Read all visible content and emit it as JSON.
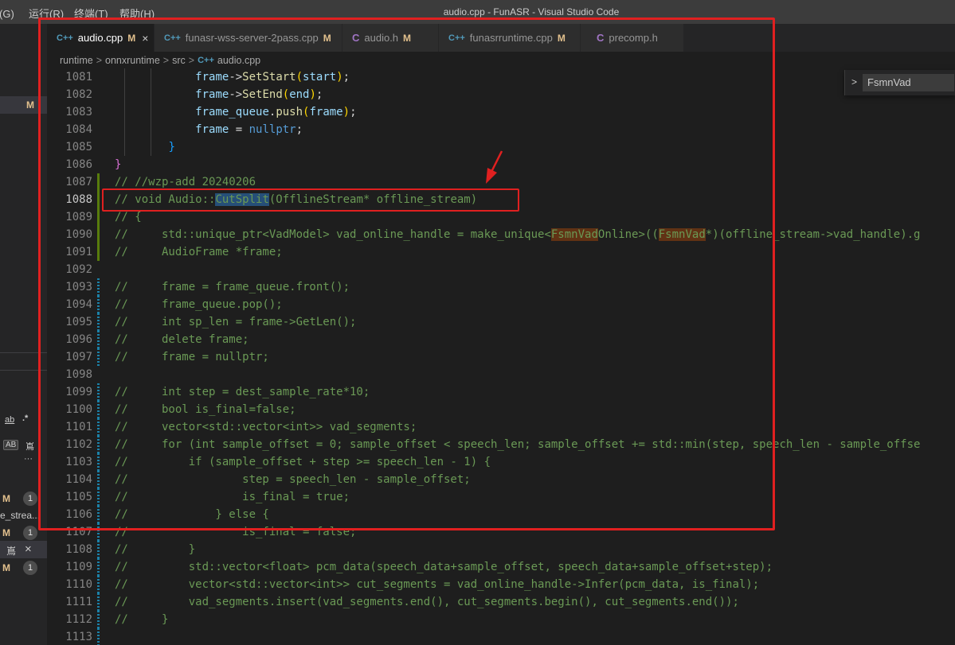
{
  "window": {
    "title": "audio.cpp - FunASR - Visual Studio Code"
  },
  "menu": {
    "items": [
      "运行(R)",
      "终端(T)",
      "帮助(H)"
    ],
    "cropped_item": "到(G)"
  },
  "tabs": [
    {
      "label": "audio.cpp",
      "icon": "C++",
      "modified": "M",
      "close": "×"
    },
    {
      "label": "funasr-wss-server-2pass.cpp",
      "icon": "C++",
      "modified": "M"
    },
    {
      "label": "audio.h",
      "icon": "C",
      "modified": "M"
    },
    {
      "label": "funasrruntime.cpp",
      "icon": "C++",
      "modified": "M"
    },
    {
      "label": "precomp.h",
      "icon": "C",
      "modified": ""
    }
  ],
  "breadcrumb": {
    "parts": [
      "runtime",
      "onnxruntime",
      "src"
    ],
    "file": "audio.cpp",
    "sep": ">",
    "file_icon": "C++"
  },
  "outline": {
    "value": "FsmnVad",
    "chevron": ">"
  },
  "sidebar": {
    "modified_mark": "M",
    "icon_ab": "ab",
    "icon_regex": ".*",
    "icon_AB": "AB",
    "icon_preserve": "嶌",
    "more": "···",
    "scm": [
      {
        "status": "M",
        "count": "1"
      },
      {
        "label": "e_strea...",
        "status": "",
        "count": ""
      },
      {
        "status": "M",
        "count": "1"
      },
      {
        "icon": "嶌",
        "close": "×"
      },
      {
        "status": "M",
        "count": "1"
      }
    ]
  },
  "code": {
    "current_line": 1088,
    "lines": [
      {
        "n": "1081",
        "t": "            frame->SetStart(start);"
      },
      {
        "n": "1082",
        "t": "            frame->SetEnd(end);"
      },
      {
        "n": "1083",
        "t": "            frame_queue.push(frame);"
      },
      {
        "n": "1084",
        "t": "            frame = nullptr;"
      },
      {
        "n": "1085",
        "t": "        }"
      },
      {
        "n": "1086",
        "t": "}"
      },
      {
        "n": "1087",
        "t": "// //wzp-add 20240206"
      },
      {
        "n": "1088",
        "t": "// void Audio::CutSplit(OfflineStream* offline_stream)"
      },
      {
        "n": "1089",
        "t": "// {"
      },
      {
        "n": "1090",
        "t": "//     std::unique_ptr<VadModel> vad_online_handle = make_unique<FsmnVadOnline>((FsmnVad*)(offline_stream->vad_handle).g"
      },
      {
        "n": "1091",
        "t": "//     AudioFrame *frame;"
      },
      {
        "n": "1092",
        "t": ""
      },
      {
        "n": "1093",
        "t": "//     frame = frame_queue.front();"
      },
      {
        "n": "1094",
        "t": "//     frame_queue.pop();"
      },
      {
        "n": "1095",
        "t": "//     int sp_len = frame->GetLen();"
      },
      {
        "n": "1096",
        "t": "//     delete frame;"
      },
      {
        "n": "1097",
        "t": "//     frame = nullptr;"
      },
      {
        "n": "1098",
        "t": ""
      },
      {
        "n": "1099",
        "t": "//     int step = dest_sample_rate*10;"
      },
      {
        "n": "1100",
        "t": "//     bool is_final=false;"
      },
      {
        "n": "1101",
        "t": "//     vector<std::vector<int>> vad_segments;"
      },
      {
        "n": "1102",
        "t": "//     for (int sample_offset = 0; sample_offset < speech_len; sample_offset += std::min(step, speech_len - sample_offse"
      },
      {
        "n": "1103",
        "t": "//         if (sample_offset + step >= speech_len - 1) {"
      },
      {
        "n": "1104",
        "t": "//                 step = speech_len - sample_offset;"
      },
      {
        "n": "1105",
        "t": "//                 is_final = true;"
      },
      {
        "n": "1106",
        "t": "//             } else {"
      },
      {
        "n": "1107",
        "t": "//                 is_final = false;"
      },
      {
        "n": "1108",
        "t": "//         }"
      },
      {
        "n": "1109",
        "t": "//         std::vector<float> pcm_data(speech_data+sample_offset, speech_data+sample_offset+step);"
      },
      {
        "n": "1110",
        "t": "//         vector<std::vector<int>> cut_segments = vad_online_handle->Infer(pcm_data, is_final);"
      },
      {
        "n": "1111",
        "t": "//         vad_segments.insert(vad_segments.end(), cut_segments.begin(), cut_segments.end());"
      },
      {
        "n": "1112",
        "t": "//     }"
      },
      {
        "n": "1113",
        "t": ""
      }
    ]
  },
  "colors": {
    "editor_bg": "#1e1e1e",
    "comment": "#6a9955",
    "variable": "#9cdcfe",
    "function": "#dcdcaa",
    "keyword": "#569cd6",
    "annotation": "#e02020",
    "modified": "#e2c08d"
  },
  "icons": [
    "cpp-file-icon",
    "c-file-icon",
    "close-icon",
    "chevron-right-icon",
    "arrow-annotation"
  ]
}
